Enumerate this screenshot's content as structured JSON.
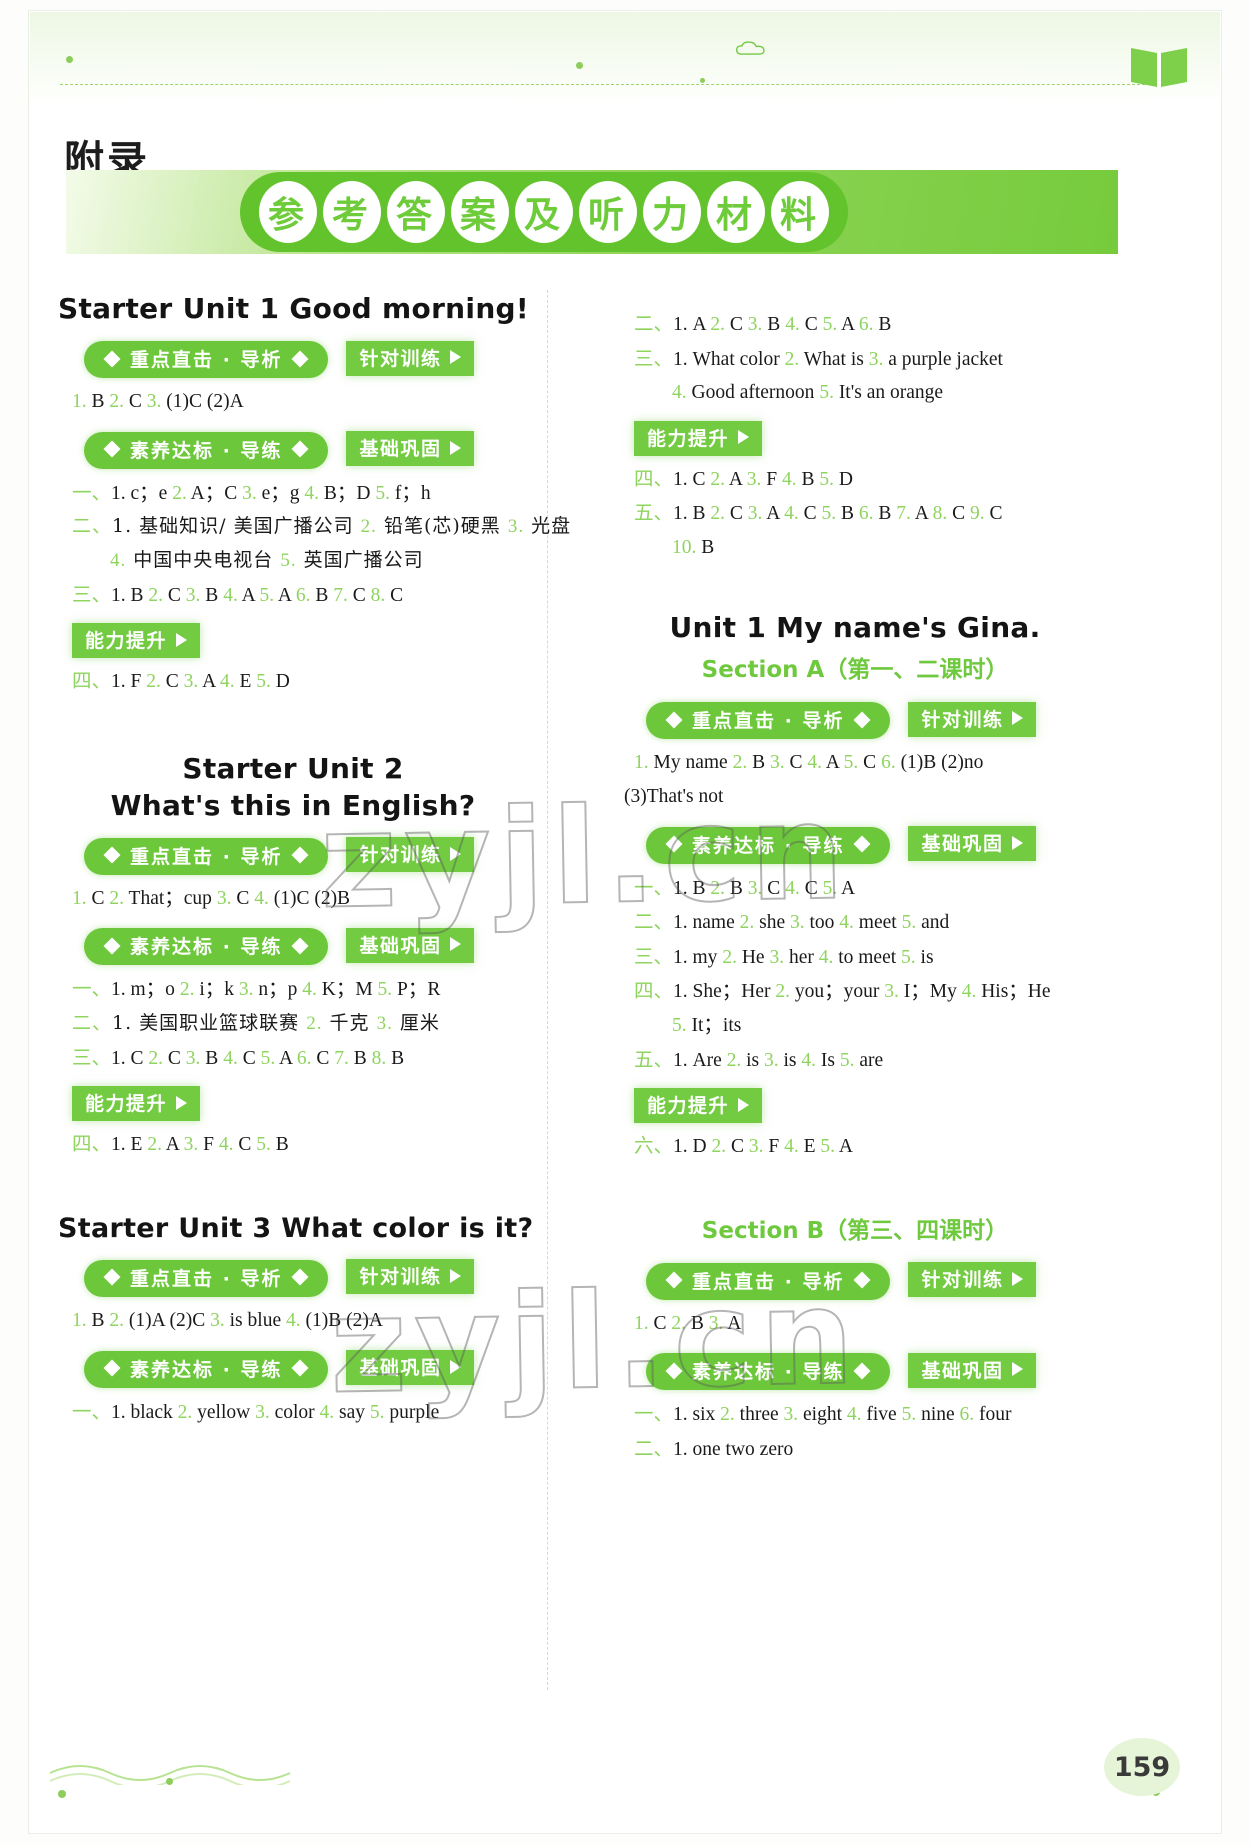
{
  "header": {
    "appendix_label": "附录",
    "banner_chars": [
      "参",
      "考",
      "答",
      "案",
      "及",
      "听",
      "力",
      "材",
      "料"
    ],
    "book_icon": "book-icon",
    "cloud_icon": "cloud-icon"
  },
  "labels": {
    "key_analysis": "重点直击 · 导析",
    "targeted_practice": "针对训练",
    "literacy_standard": "素养达标 · 导练",
    "basic_consolidation": "基础巩固",
    "ability_improvement": "能力提升"
  },
  "watermark": {
    "line1": "zyjl.cn",
    "line2": "zyjl.cn"
  },
  "footer": {
    "page_number": "159"
  },
  "left_column": {
    "unit1": {
      "title": "Starter Unit 1 Good morning!",
      "targeted": [
        "1. B   2. C   3. (1)C   (2)A"
      ],
      "basic": [
        "一、1. c；e   2. A；C   3. e；g   4. B；D   5. f；h",
        "二、1. 基础知识/ 美国广播公司   2. 铅笔(芯)硬黑   3. 光盘",
        "4. 中国中央电视台   5. 英国广播公司",
        "三、1. B   2. C   3. B   4. A   5. A   6. B   7. C   8. C"
      ],
      "ability": [
        "四、1. F   2. C   3. A   4. E   5. D"
      ]
    },
    "unit2": {
      "title_line1": "Starter Unit 2",
      "title_line2": "What's this in English?",
      "targeted": [
        "1. C   2. That；cup   3. C   4. (1)C   (2)B"
      ],
      "basic": [
        "一、1. m；o   2. i；k   3. n；p   4. K；M   5. P；R",
        "二、1. 美国职业篮球联赛   2. 千克   3. 厘米",
        "三、1. C   2. C   3. B   4. C   5. A   6. C   7. B   8. B"
      ],
      "ability": [
        "四、1. E   2. A   3. F   4. C   5. B"
      ]
    },
    "unit3": {
      "title": "Starter Unit 3   What color is it?",
      "targeted": [
        "1. B   2. (1)A   (2)C   3. is blue   4. (1)B   (2)A"
      ],
      "basic": [
        "一、1. black   2. yellow   3. color   4. say   5. purple"
      ]
    }
  },
  "right_column": {
    "unit3_cont": {
      "basic": [
        "二、1. A   2. C   3. B   4. C   5. A   6. B",
        "三、1. What color   2. What is   3. a purple jacket",
        "4. Good afternoon   5. It's an orange"
      ],
      "ability": [
        "四、1. C   2. A   3. F   4. B   5. D",
        "五、1. B   2. C   3. A   4. C   5. B   6. B   7. A   8. C   9. C",
        "10. B"
      ]
    },
    "unit1": {
      "title": "Unit 1   My name's Gina.",
      "section_a": {
        "title": "Section A（第一、二课时）",
        "targeted": [
          "1. My name   2. B   3. C   4. A   5. C   6. (1)B   (2)no",
          "(3)That's not"
        ],
        "basic": [
          "一、1. B   2. B   3. C   4. C   5. A",
          "二、1. name   2. she   3. too   4. meet   5. and",
          "三、1. my   2. He   3. her   4. to meet   5. is",
          "四、1. She；Her   2. you；your   3. I；My   4. His；He",
          "5. It；its",
          "五、1. Are   2. is   3. is   4. Is   5. are"
        ],
        "ability": [
          "六、1. D   2. C   3. F   4. E   5. A"
        ]
      },
      "section_b": {
        "title": "Section B（第三、四课时）",
        "targeted": [
          "1. C   2. B   3. A"
        ],
        "basic": [
          "一、1. six   2. three   3. eight   4. five   5. nine   6. four",
          "二、1. one two zero"
        ]
      }
    }
  }
}
